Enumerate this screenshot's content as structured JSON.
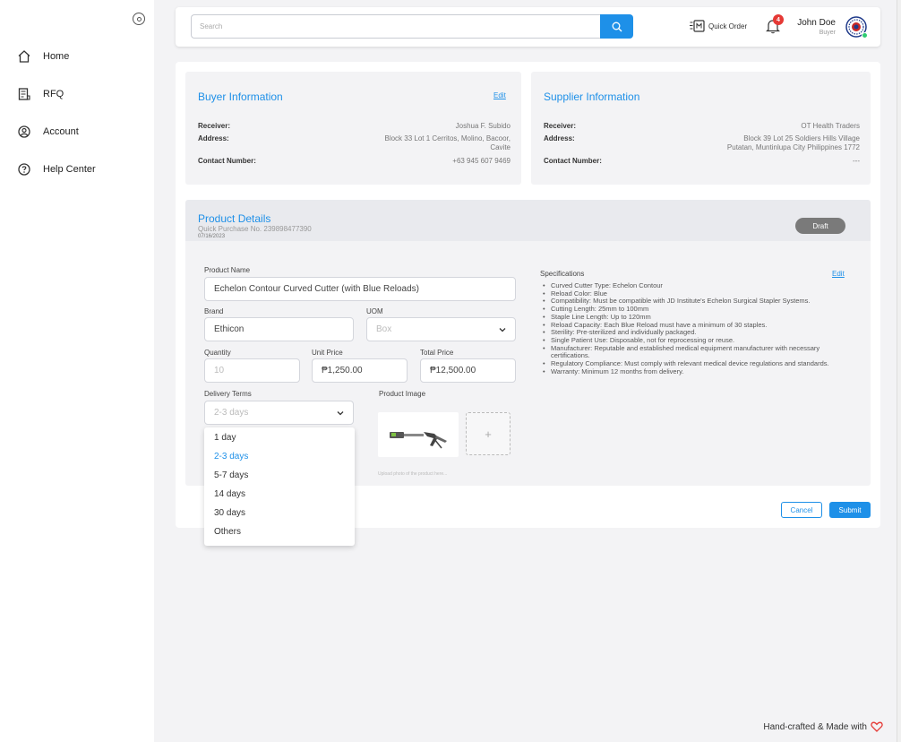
{
  "sidebar": {
    "items": [
      {
        "label": "Home",
        "icon": "home-icon"
      },
      {
        "label": "RFQ",
        "icon": "rfq-icon"
      },
      {
        "label": "Account",
        "icon": "account-icon"
      },
      {
        "label": "Help Center",
        "icon": "help-icon"
      }
    ]
  },
  "header": {
    "search_placeholder": "Search",
    "quick_order_label": "Quick Order",
    "notification_count": "4",
    "user_name": "John Doe",
    "user_role": "Buyer"
  },
  "buyer": {
    "title": "Buyer Information",
    "edit_label": "Edit",
    "receiver_label": "Receiver:",
    "receiver": "Joshua F. Subido",
    "address_label": "Address:",
    "address_line1": "Block 33 Lot 1 Cerritos, Molino, Bacoor,",
    "address_line2": "Cavite",
    "contact_label": "Contact Number:",
    "contact": "+63 945 607 9469"
  },
  "supplier": {
    "title": "Supplier Information",
    "receiver_label": "Receiver:",
    "receiver": "OT Health Traders",
    "address_label": "Address:",
    "address_line1": "Block 39 Lot 25 Soldiers Hills Village",
    "address_line2": "Putatan, Muntinlupa City Philippines 1772",
    "contact_label": "Contact Number:",
    "contact": "---"
  },
  "product": {
    "title": "Product Details",
    "purchase_no": "Quick Purchase No. 239898477390",
    "date": "07/16/2023",
    "status": "Draft",
    "name_label": "Product Name",
    "name": "Echelon Contour Curved Cutter (with Blue Reloads)",
    "brand_label": "Brand",
    "brand": "Ethicon",
    "uom_label": "UOM",
    "uom_placeholder": "Box",
    "quantity_label": "Quantity",
    "quantity_placeholder": "10",
    "unit_price_label": "Unit Price",
    "unit_price": "₱1,250.00",
    "total_price_label": "Total Price",
    "total_price": "₱12,500.00",
    "delivery_label": "Delivery Terms",
    "delivery_value": "2-3 days",
    "image_label": "Product Image",
    "image_add": "+",
    "image_hint": "Upload photo of the product here...",
    "spec_title": "Specifications",
    "spec_edit": "Edit",
    "specs": [
      "Curved Cutter Type: Echelon Contour",
      "Reload Color: Blue",
      "Compatibility: Must be compatible with JD Institute's Echelon Surgical Stapler Systems.",
      "Cutting Length: 25mm to 100mm",
      "Staple Line Length: Up to 120mm",
      "Reload Capacity: Each Blue Reload must have a minimum of 30 staples.",
      "Sterility: Pre-sterilized and individually packaged.",
      "Single Patient Use: Disposable, not for reprocessing or reuse.",
      "Manufacturer: Reputable and established medical equipment manufacturer with necessary certifications.",
      "Regulatory Compliance: Must comply with relevant medical device regulations and standards.",
      "Warranty: Minimum 12 months from delivery."
    ]
  },
  "actions": {
    "cancel": "Cancel",
    "submit": "Submit"
  },
  "delivery_dropdown": {
    "options": [
      "1 day",
      "2-3 days",
      "5-7 days",
      "14 days",
      "30 days",
      "Others"
    ],
    "selected": "2-3 days"
  },
  "footer": {
    "text": "Hand-crafted & Made with"
  },
  "colors": {
    "accent": "#1e90e8",
    "badge": "#e53935",
    "draft": "#7a7a7a"
  }
}
